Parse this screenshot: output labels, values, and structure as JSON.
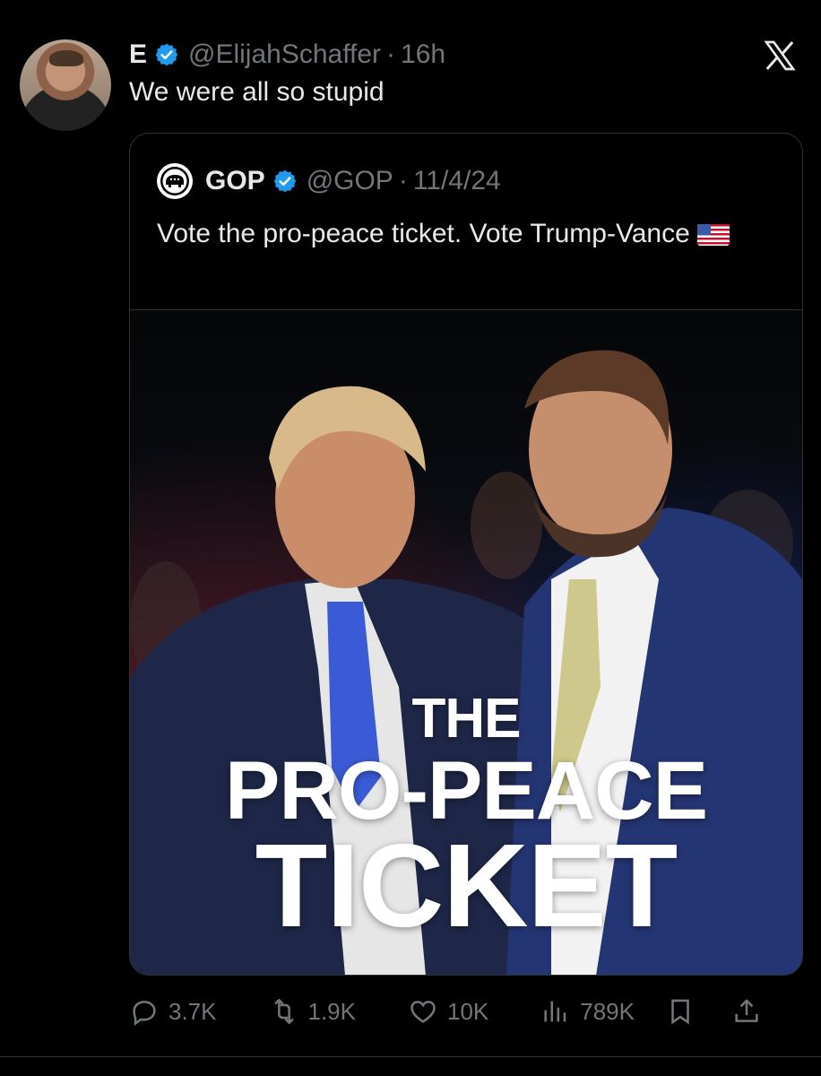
{
  "tweet": {
    "display_name": "E",
    "handle": "@ElijahSchaffer",
    "separator": "·",
    "time": "16h",
    "text": "We were all so stupid"
  },
  "quoted": {
    "display_name": "GOP",
    "handle": "@GOP",
    "separator": "·",
    "date": "11/4/24",
    "text": "Vote the pro-peace ticket. Vote Trump-Vance",
    "image_text": {
      "line1": "THE",
      "line2": "PRO-PEACE",
      "line3": "TICKET"
    }
  },
  "actions": {
    "replies": "3.7K",
    "reposts": "1.9K",
    "likes": "10K",
    "views": "789K"
  },
  "colors": {
    "background": "#000000",
    "text": "#e7e9ea",
    "muted": "#71767b",
    "verified": "#1d9bf0",
    "border": "#2f3336"
  },
  "icons": [
    "x-logo-icon",
    "verified-badge-icon",
    "gop-elephant-icon",
    "us-flag-icon",
    "reply-icon",
    "repost-icon",
    "like-icon",
    "views-icon",
    "bookmark-icon",
    "share-icon"
  ]
}
